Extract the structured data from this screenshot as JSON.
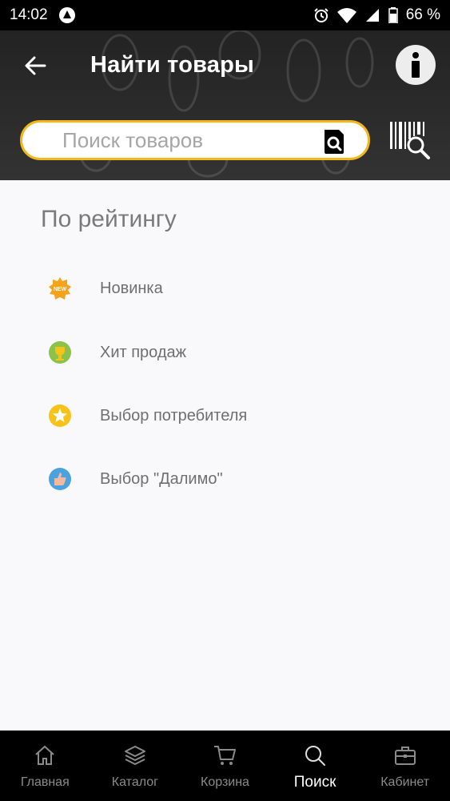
{
  "status_bar": {
    "time": "14:02",
    "battery": "66 %"
  },
  "header": {
    "title": "Найти товары"
  },
  "search": {
    "placeholder": "Поиск товаров"
  },
  "section": {
    "title": "По рейтингу",
    "items": [
      {
        "label": "Новинка",
        "icon": "new-badge-icon",
        "color": "#f5a31a"
      },
      {
        "label": "Хит продаж",
        "icon": "trophy-icon",
        "color": "#8bc34a"
      },
      {
        "label": "Выбор потребителя",
        "icon": "star-icon",
        "color": "#f7c21a"
      },
      {
        "label": "Выбор \"Далимо\"",
        "icon": "thumbs-up-icon",
        "color": "#4aa3df"
      }
    ]
  },
  "bottom_nav": {
    "tabs": [
      {
        "label": "Главная",
        "icon": "home-icon"
      },
      {
        "label": "Каталог",
        "icon": "layers-icon"
      },
      {
        "label": "Корзина",
        "icon": "cart-icon"
      },
      {
        "label": "Поиск",
        "icon": "search-icon",
        "active": true
      },
      {
        "label": "Кабинет",
        "icon": "briefcase-icon"
      }
    ]
  },
  "colors": {
    "accent": "#f3b71b",
    "header_bg": "#2b2b2b",
    "nav_bg": "#000000"
  }
}
